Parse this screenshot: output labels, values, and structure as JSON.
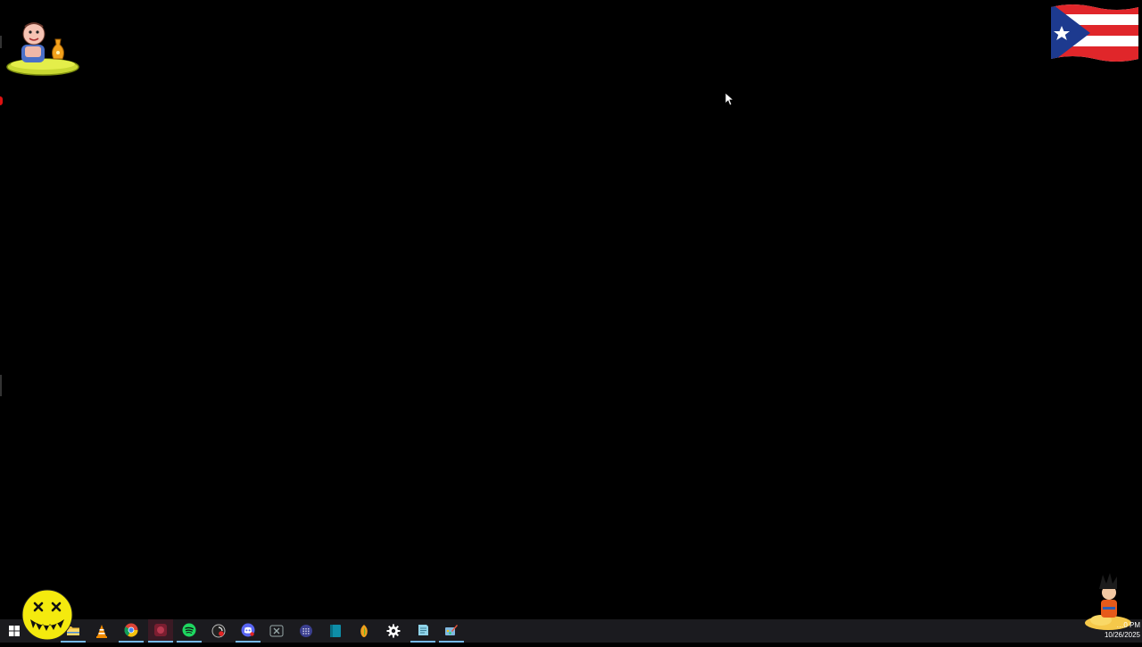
{
  "desktop": {
    "background_color": "#000000",
    "widgets": {
      "top_left": "cartoon-pet-widget",
      "top_right": "puerto-rico-flag",
      "bottom_left": "yellow-smiley-widget",
      "bottom_right": "goku-nimbus-widget"
    }
  },
  "taskbar": {
    "background_color": "#1b1b1f",
    "accent_color": "#76b9ed",
    "items": [
      {
        "icon": "windows-start-icon"
      },
      {
        "icon": "file-explorer-icon"
      },
      {
        "icon": "vlc-icon"
      },
      {
        "icon": "chrome-icon"
      },
      {
        "icon": "red-app-icon"
      },
      {
        "icon": "spotify-icon"
      },
      {
        "icon": "obs-record-icon"
      },
      {
        "icon": "discord-icon"
      },
      {
        "icon": "x-app-icon"
      },
      {
        "icon": "keypad-app-icon"
      },
      {
        "icon": "teal-book-icon"
      },
      {
        "icon": "fl-studio-icon"
      },
      {
        "icon": "settings-gear-icon"
      },
      {
        "icon": "notepad-icon"
      },
      {
        "icon": "paint-icon"
      }
    ]
  },
  "tray": {
    "time": "…0 PM",
    "date": "10/26/2025"
  }
}
